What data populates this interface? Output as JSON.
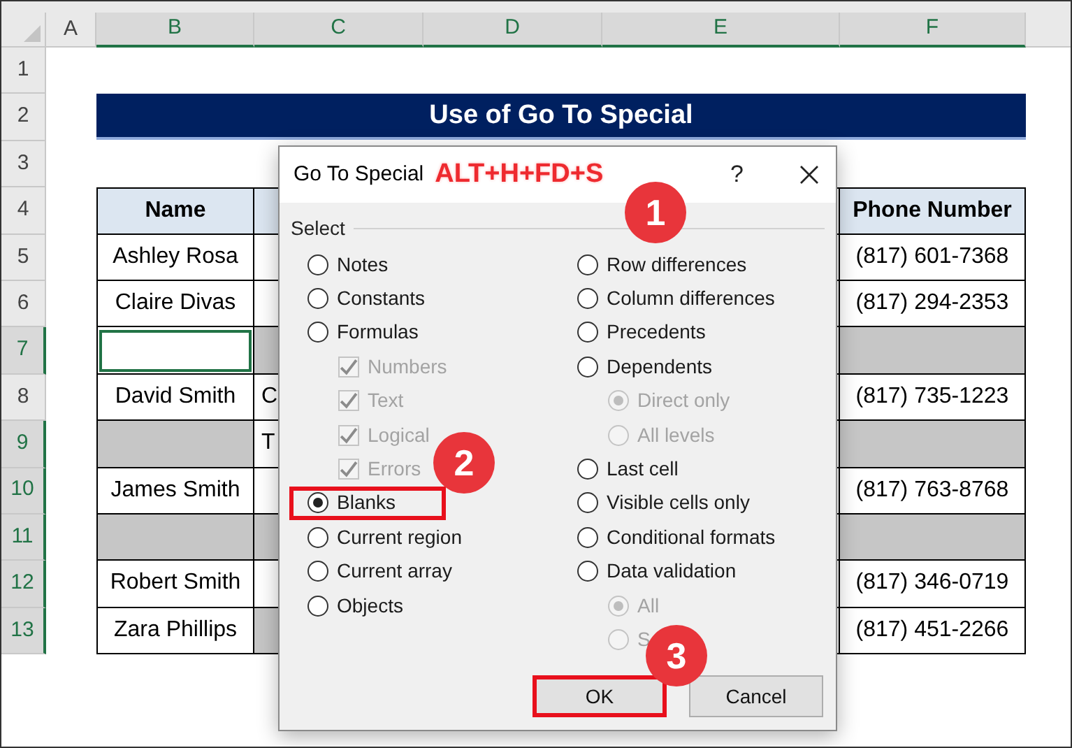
{
  "sheet": {
    "columns": [
      {
        "label": "A",
        "selected": false
      },
      {
        "label": "B",
        "selected": true
      },
      {
        "label": "C",
        "selected": true
      },
      {
        "label": "D",
        "selected": true
      },
      {
        "label": "E",
        "selected": true
      },
      {
        "label": "F",
        "selected": true
      }
    ],
    "rows": [
      {
        "label": "1",
        "selected": false
      },
      {
        "label": "2",
        "selected": false
      },
      {
        "label": "3",
        "selected": false
      },
      {
        "label": "4",
        "selected": false
      },
      {
        "label": "5",
        "selected": false
      },
      {
        "label": "6",
        "selected": false
      },
      {
        "label": "7",
        "selected": true
      },
      {
        "label": "8",
        "selected": false
      },
      {
        "label": "9",
        "selected": true
      },
      {
        "label": "10",
        "selected": true
      },
      {
        "label": "11",
        "selected": true
      },
      {
        "label": "12",
        "selected": true
      },
      {
        "label": "13",
        "selected": true
      }
    ],
    "title": "Use of Go To Special",
    "table": [
      {
        "cells": [
          {
            "kind": "header",
            "text": "Name"
          },
          {
            "kind": "header"
          },
          {
            "kind": "header",
            "text": "Phone Number"
          }
        ]
      },
      {
        "cells": [
          {
            "kind": "data",
            "text": "Ashley Rosa",
            "highlighted": false,
            "active": false
          },
          {
            "kind": "data",
            "highlighted": false,
            "active": false
          },
          {
            "kind": "data",
            "text": "(817) 601-7368",
            "highlighted": false,
            "active": false
          }
        ]
      },
      {
        "cells": [
          {
            "kind": "data",
            "text": "Claire Divas",
            "highlighted": false,
            "active": false
          },
          {
            "kind": "data",
            "highlighted": false,
            "active": false
          },
          {
            "kind": "data",
            "text": "(817) 294-2353",
            "highlighted": false,
            "active": false
          }
        ]
      },
      {
        "cells": [
          {
            "kind": "data",
            "highlighted": false,
            "active": true
          },
          {
            "kind": "data",
            "highlighted": true,
            "active": false
          },
          {
            "kind": "data",
            "highlighted": true,
            "active": false
          }
        ]
      },
      {
        "cells": [
          {
            "kind": "data",
            "text": "David Smith",
            "highlighted": false,
            "active": false
          },
          {
            "kind": "data",
            "text": "C",
            "highlighted": false,
            "active": false
          },
          {
            "kind": "data",
            "text": "(817) 735-1223",
            "highlighted": false,
            "active": false
          }
        ]
      },
      {
        "cells": [
          {
            "kind": "data",
            "highlighted": true,
            "active": false
          },
          {
            "kind": "data",
            "text": "T",
            "highlighted": false,
            "active": false
          },
          {
            "kind": "data",
            "highlighted": true,
            "active": false
          }
        ]
      },
      {
        "cells": [
          {
            "kind": "data",
            "text": "James Smith",
            "highlighted": false,
            "active": false
          },
          {
            "kind": "data",
            "highlighted": false,
            "active": false
          },
          {
            "kind": "data",
            "text": "(817) 763-8768",
            "highlighted": false,
            "active": false
          }
        ]
      },
      {
        "cells": [
          {
            "kind": "data",
            "highlighted": true,
            "active": false
          },
          {
            "kind": "data",
            "highlighted": true,
            "active": false
          },
          {
            "kind": "data",
            "highlighted": true,
            "active": false
          }
        ]
      },
      {
        "cells": [
          {
            "kind": "data",
            "text": "Robert Smith",
            "highlighted": false,
            "active": false
          },
          {
            "kind": "data",
            "highlighted": false,
            "active": false
          },
          {
            "kind": "data",
            "text": "(817) 346-0719",
            "highlighted": false,
            "active": false
          }
        ]
      },
      {
        "cells": [
          {
            "kind": "data",
            "text": "Zara Phillips",
            "highlighted": false,
            "active": false
          },
          {
            "kind": "data",
            "highlighted": true,
            "active": false
          },
          {
            "kind": "data",
            "text": "(817) 451-2266",
            "highlighted": false,
            "active": false
          }
        ]
      }
    ]
  },
  "dialog": {
    "title": "Go To Special",
    "shortcut": "ALT+H+FD+S",
    "help": "?",
    "group": "Select",
    "left_options": [
      {
        "kind": "radio",
        "label": "Notes",
        "selected": false,
        "disabled": false,
        "highlighted": false
      },
      {
        "kind": "radio",
        "label": "Constants",
        "selected": false,
        "disabled": false,
        "highlighted": false
      },
      {
        "kind": "radio",
        "label": "Formulas",
        "selected": false,
        "disabled": false,
        "highlighted": false,
        "children": [
          {
            "kind": "checkbox",
            "label": "Numbers",
            "checked": true,
            "disabled": true,
            "highlighted": false
          },
          {
            "kind": "checkbox",
            "label": "Text",
            "checked": true,
            "disabled": true,
            "highlighted": false
          },
          {
            "kind": "checkbox",
            "label": "Logical",
            "checked": true,
            "disabled": true,
            "highlighted": false
          },
          {
            "kind": "checkbox",
            "label": "Errors",
            "checked": true,
            "disabled": true,
            "highlighted": false
          }
        ]
      },
      {
        "kind": "radio",
        "label": "Blanks",
        "selected": true,
        "disabled": false,
        "highlighted": true
      },
      {
        "kind": "radio",
        "label": "Current region",
        "selected": false,
        "disabled": false,
        "highlighted": false
      },
      {
        "kind": "radio",
        "label": "Current array",
        "selected": false,
        "disabled": false,
        "highlighted": false
      },
      {
        "kind": "radio",
        "label": "Objects",
        "selected": false,
        "disabled": false,
        "highlighted": false
      }
    ],
    "right_options": [
      {
        "kind": "radio",
        "label": "Row differences",
        "selected": false,
        "disabled": false,
        "highlighted": false
      },
      {
        "kind": "radio",
        "label": "Column differences",
        "selected": false,
        "disabled": false,
        "highlighted": false
      },
      {
        "kind": "radio",
        "label": "Precedents",
        "selected": false,
        "disabled": false,
        "highlighted": false
      },
      {
        "kind": "radio",
        "label": "Dependents",
        "selected": false,
        "disabled": false,
        "highlighted": false,
        "children": [
          {
            "kind": "radio",
            "label": "Direct only",
            "selected": true,
            "disabled": true,
            "highlighted": false
          },
          {
            "kind": "radio",
            "label": "All levels",
            "selected": false,
            "disabled": true,
            "highlighted": false
          }
        ]
      },
      {
        "kind": "radio",
        "label": "Last cell",
        "selected": false,
        "disabled": false,
        "highlighted": false
      },
      {
        "kind": "radio",
        "label": "Visible cells only",
        "selected": false,
        "disabled": false,
        "highlighted": false
      },
      {
        "kind": "radio",
        "label": "Conditional formats",
        "selected": false,
        "disabled": false,
        "highlighted": false
      },
      {
        "kind": "radio",
        "label": "Data validation",
        "selected": false,
        "disabled": false,
        "highlighted": false,
        "children": [
          {
            "kind": "radio",
            "label": "All",
            "selected": true,
            "disabled": true,
            "highlighted": false
          },
          {
            "kind": "radio",
            "label": "S",
            "selected": false,
            "disabled": true,
            "highlighted": false
          }
        ]
      }
    ],
    "buttons": [
      {
        "label": "OK",
        "highlighted": true
      },
      {
        "label": "Cancel",
        "highlighted": false
      }
    ]
  },
  "step_badges": [
    "1",
    "2",
    "3"
  ]
}
